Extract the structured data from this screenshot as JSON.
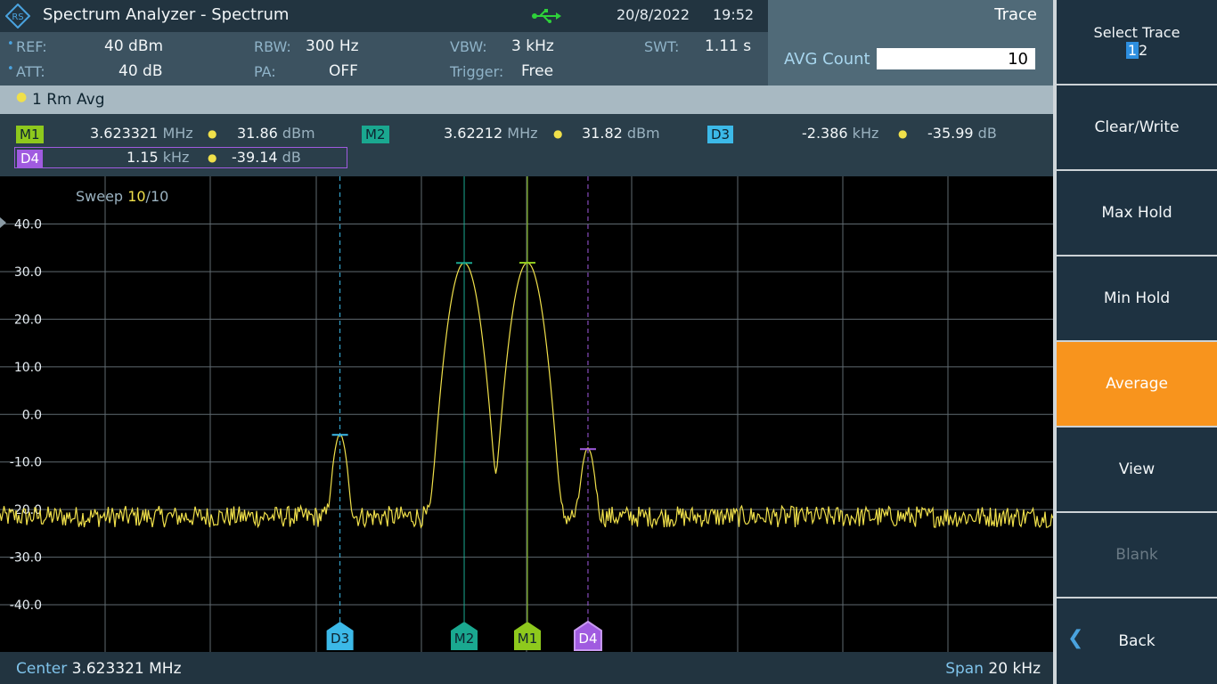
{
  "header": {
    "title": "Spectrum Analyzer - Spectrum",
    "date": "20/8/2022",
    "time": "19:52",
    "usb_icon": "usb-icon",
    "logo_icon": "rohde-schwarz-logo"
  },
  "trace_panel": {
    "title": "Trace",
    "avg_label": "AVG Count",
    "avg_value": "10"
  },
  "params": {
    "ref_label": "REF:",
    "ref_value": "40 dBm",
    "att_label": "ATT:",
    "att_value": "40 dB",
    "rbw_label": "RBW:",
    "rbw_value": "300 Hz",
    "pa_label": "PA:",
    "pa_value": "OFF",
    "vbw_label": "VBW:",
    "vbw_value": "3 kHz",
    "trigger_label": "Trigger:",
    "trigger_value": "Free",
    "swt_label": "SWT:",
    "swt_value": "1.11 s"
  },
  "trace_row": {
    "label": "1 Rm  Avg"
  },
  "markers": {
    "m1": {
      "tag": "M1",
      "freq": "3.623321",
      "freq_unit": "MHz",
      "level": "31.86",
      "level_unit": "dBm",
      "color": "#8ec91d"
    },
    "m2": {
      "tag": "M2",
      "freq": "3.62212",
      "freq_unit": "MHz",
      "level": "31.82",
      "level_unit": "dBm",
      "color": "#1aa890"
    },
    "d3": {
      "tag": "D3",
      "freq": "-2.386",
      "freq_unit": "kHz",
      "level": "-35.99",
      "level_unit": "dB",
      "color": "#3cb9e8"
    },
    "d4": {
      "tag": "D4",
      "freq": "1.15",
      "freq_unit": "kHz",
      "level": "-39.14",
      "level_unit": "dB",
      "color": "#a05be0"
    }
  },
  "plot": {
    "sweep_label": "Sweep",
    "sweep_current": "10",
    "sweep_total": "/10",
    "y_ticks": [
      "40.0",
      "30.0",
      "20.0",
      "10.0",
      "0.0",
      "-10.0",
      "-20.0",
      "-30.0",
      "-40.0"
    ]
  },
  "chart_data": {
    "type": "line",
    "y_unit": "dBm",
    "ylim": [
      -50,
      45
    ],
    "x_center_mhz": 3.623321,
    "x_span_khz": 20,
    "grid": true,
    "trace_color": "#f0e04a",
    "peaks": [
      {
        "marker": "D3",
        "offset_khz": -3.56,
        "level": -4.3
      },
      {
        "marker": "M2",
        "offset_khz": -1.201,
        "level": 31.82
      },
      {
        "marker": "M1",
        "offset_khz": 0,
        "level": 31.86
      },
      {
        "marker": "D4",
        "offset_khz": 1.15,
        "level": -7.3
      }
    ],
    "noise_floor": -21.5,
    "markers": [
      {
        "name": "D3",
        "offset_khz": -3.56,
        "level": -4.3,
        "color": "#3cb9e8",
        "dashed": true
      },
      {
        "name": "M2",
        "offset_khz": -1.201,
        "level": 31.82,
        "color": "#1aa890",
        "dashed": false
      },
      {
        "name": "M1",
        "offset_khz": 0,
        "level": 31.86,
        "color": "#8ec91d",
        "dashed": false
      },
      {
        "name": "D4",
        "offset_khz": 1.15,
        "level": -7.3,
        "color": "#a05be0",
        "dashed": true
      }
    ]
  },
  "footer": {
    "center_label": "Center",
    "center_value": "3.623321 MHz",
    "span_label": "Span",
    "span_value": "20 kHz"
  },
  "softkeys": {
    "select_trace": "Select Trace",
    "select_trace_1": "1",
    "select_trace_2": "2",
    "clear_write": "Clear/Write",
    "max_hold": "Max Hold",
    "min_hold": "Min Hold",
    "average": "Average",
    "view": "View",
    "blank": "Blank",
    "back": "Back"
  }
}
